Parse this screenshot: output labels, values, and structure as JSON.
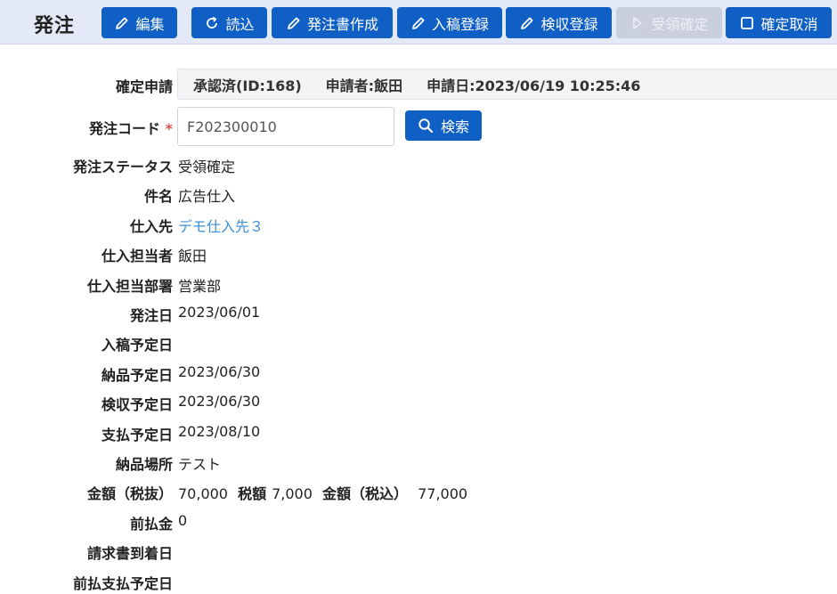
{
  "header": {
    "title": "発注",
    "buttons": [
      {
        "label": "編集",
        "icon": "pencil-icon",
        "disabled": false
      },
      {
        "label": "読込",
        "icon": "refresh-icon",
        "disabled": false
      },
      {
        "label": "発注書作成",
        "icon": "pencil-icon",
        "disabled": false
      },
      {
        "label": "入稿登録",
        "icon": "pencil-icon",
        "disabled": false
      },
      {
        "label": "検収登録",
        "icon": "pencil-icon",
        "disabled": false
      },
      {
        "label": "受領確定",
        "icon": "play-icon",
        "disabled": true
      },
      {
        "label": "確定取消",
        "icon": "square-icon",
        "disabled": false
      }
    ]
  },
  "approval": {
    "label": "確定申請",
    "status": "承認済(ID:168)",
    "applicant": "申請者:飯田",
    "date": "申請日:2023/06/19 10:25:46"
  },
  "order_code": {
    "label": "発注コード",
    "required_mark": "*",
    "value": "F202300010",
    "search_label": "検索"
  },
  "fields": {
    "status": {
      "label": "発注ステータス",
      "value": "受領確定"
    },
    "subject": {
      "label": "件名",
      "value": "広告仕入"
    },
    "supplier": {
      "label": "仕入先",
      "value": "デモ仕入先３"
    },
    "person": {
      "label": "仕入担当者",
      "value": "飯田"
    },
    "department": {
      "label": "仕入担当部署",
      "value": "営業部"
    },
    "order_date": {
      "label": "発注日",
      "value": "2023/06/01"
    },
    "submission_date": {
      "label": "入稿予定日",
      "value": ""
    },
    "delivery_date": {
      "label": "納品予定日",
      "value": "2023/06/30"
    },
    "inspection_date": {
      "label": "検収予定日",
      "value": "2023/06/30"
    },
    "payment_date": {
      "label": "支払予定日",
      "value": "2023/08/10"
    },
    "delivery_place": {
      "label": "納品場所",
      "value": "テスト"
    },
    "amount": {
      "label": "金額（税抜）",
      "value": "70,000",
      "tax_label": "税額",
      "tax_value": "7,000",
      "total_label": "金額（税込）",
      "total_value": "77,000"
    },
    "advance": {
      "label": "前払金",
      "value": "0"
    },
    "invoice_arrival": {
      "label": "請求書到着日",
      "value": ""
    },
    "advance_payment_date": {
      "label": "前払支払予定日",
      "value": ""
    }
  }
}
